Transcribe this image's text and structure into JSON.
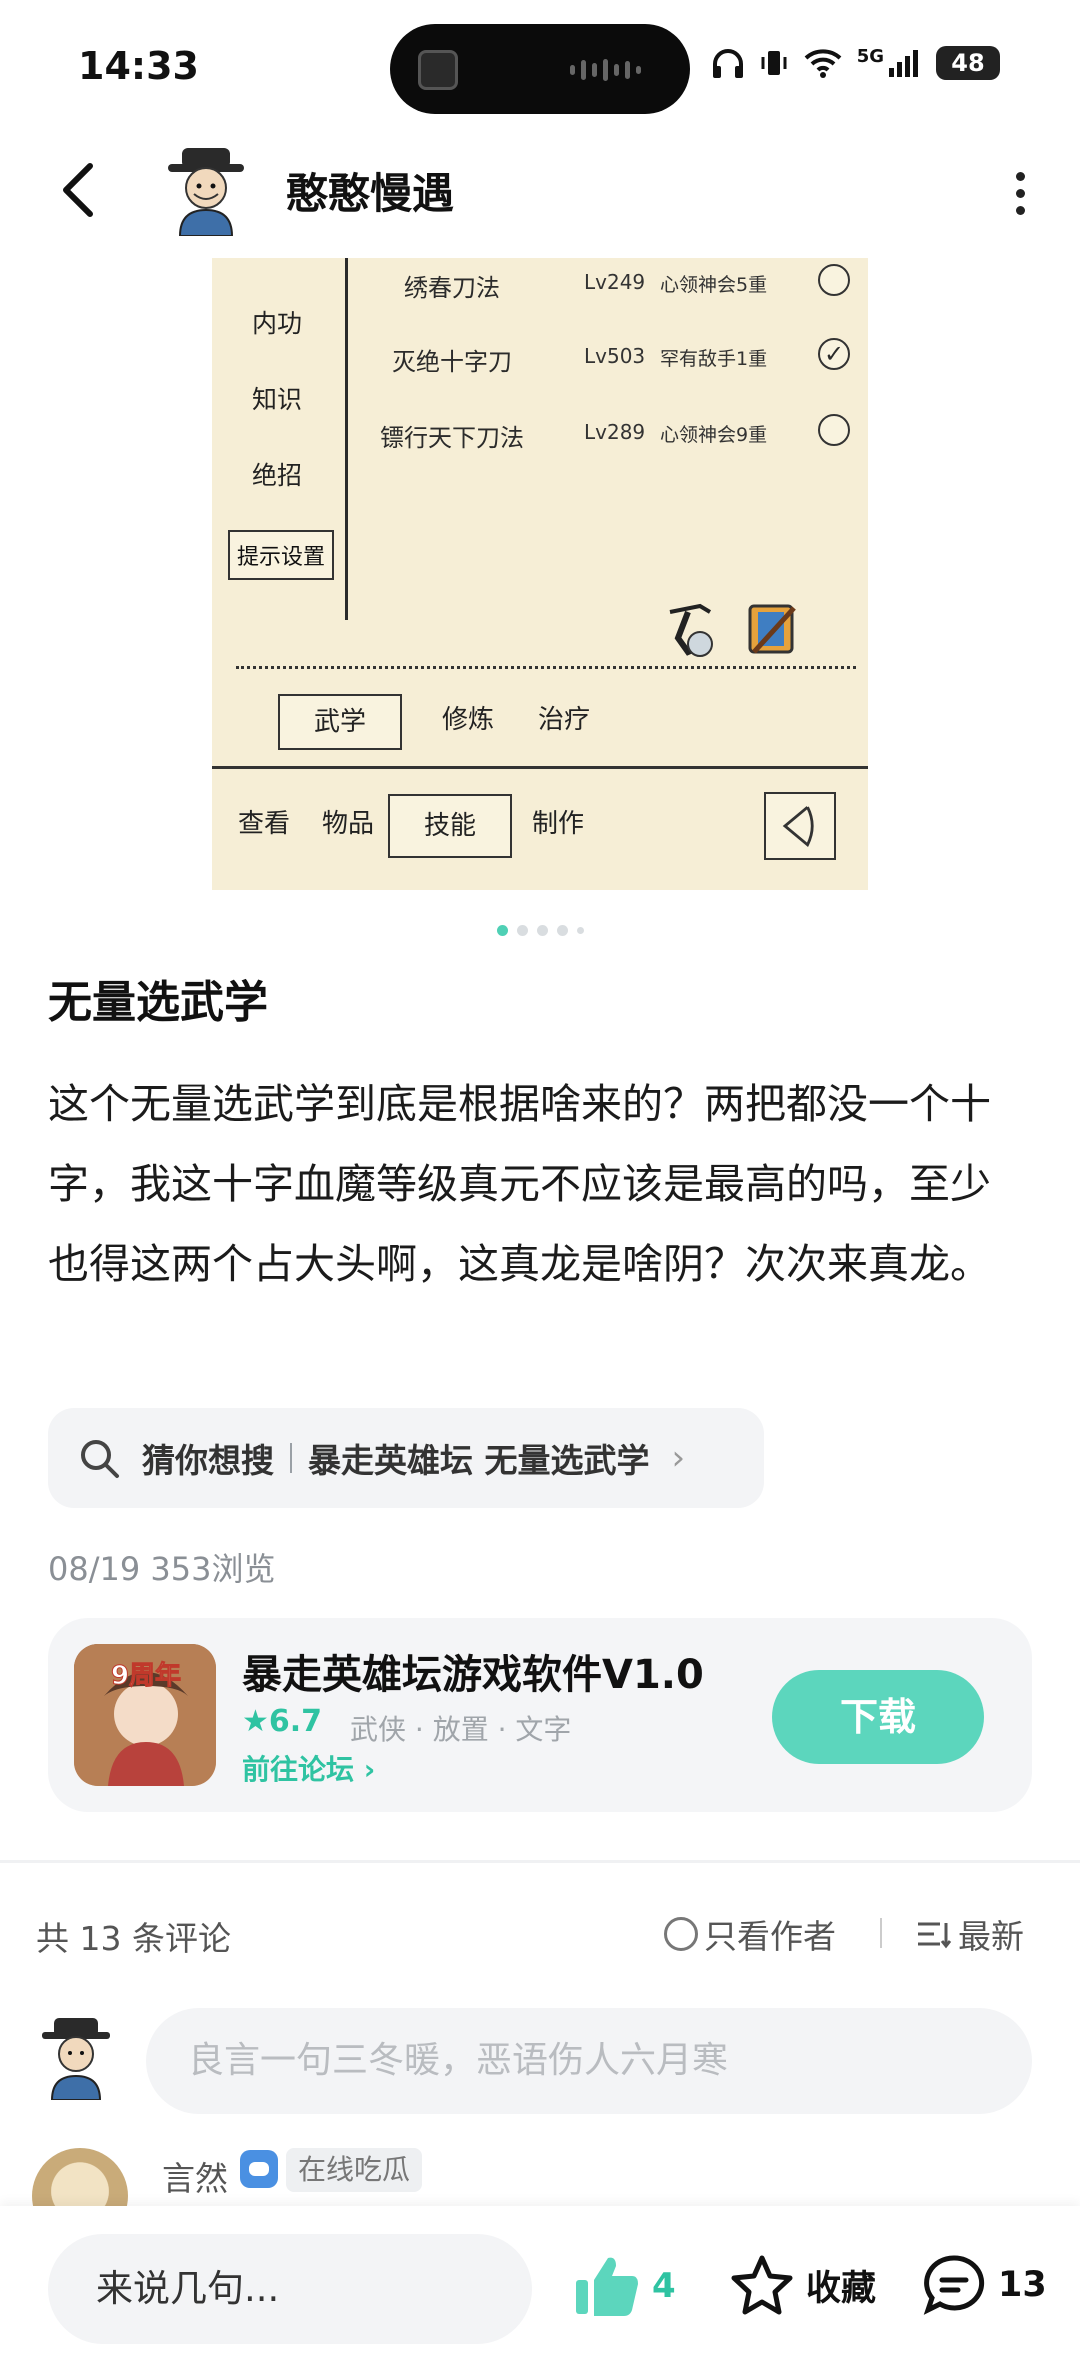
{
  "status": {
    "time": "14:33",
    "battery": "48",
    "net": "5G"
  },
  "header": {
    "title": "憨憨慢遇"
  },
  "game": {
    "side_tabs": [
      "内功",
      "知识",
      "绝招"
    ],
    "hint_settings": "提示设置",
    "skills": [
      {
        "name": "绣春刀法",
        "level": "Lv249",
        "mastery": "心领神会5重",
        "checked": false
      },
      {
        "name": "灭绝十字刀",
        "level": "Lv503",
        "mastery": "罕有敌手1重",
        "checked": true
      },
      {
        "name": "镖行天下刀法",
        "level": "Lv289",
        "mastery": "心领神会9重",
        "checked": false
      }
    ],
    "sub_tabs": [
      "武学",
      "修炼",
      "治疗"
    ],
    "main_tabs": [
      "查看",
      "物品",
      "技能",
      "制作"
    ]
  },
  "post": {
    "title": "无量选武学",
    "body": "这个无量选武学到底是根据啥来的？两把都没一个十字，我这十字血魔等级真元不应该是最高的吗，至少也得这两个占大头啊，这真龙是啥阴？次次来真龙。",
    "search_prefix": "猜你想搜",
    "search_query": "暴走英雄坛 无量选武学",
    "meta": "08/19  353浏览"
  },
  "app": {
    "name": "暴走英雄坛游戏软件V1.0",
    "rating": "★6.7",
    "tags": "武侠 · 放置 · 文字",
    "forum_link": "前往论坛 ›",
    "download": "下载"
  },
  "comments": {
    "count_label": "共 13 条评论",
    "only_author": "只看作者",
    "sort": "最新",
    "input_placeholder": "良言一句三冬暖，恶语伤人六月寒",
    "first": {
      "name": "言然",
      "tag": "在线吃瓜"
    }
  },
  "bottom": {
    "say": "来说几句...",
    "likes": "4",
    "fav": "收藏",
    "comments": "13"
  },
  "colors": {
    "accent": "#5cd6bd",
    "accent_text": "#2fc3a2",
    "game_bg": "#f6eed6"
  }
}
